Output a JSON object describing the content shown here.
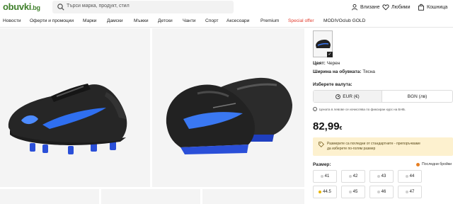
{
  "header": {
    "logo_main": "obuvki",
    "logo_tld": ".bg",
    "search_placeholder": "Търси марка, продукт, стил",
    "login": "Влизане",
    "favorites": "Любими",
    "cart": "Кошница"
  },
  "nav": {
    "items": [
      "Новости",
      "Оферти и промоции",
      "Марки",
      "Дамски",
      "Мъжки",
      "Детски",
      "Чанти",
      "Спорт",
      "Аксесоари",
      "Premium",
      "Special offer",
      "MODIVOclub GOLD"
    ],
    "special_color": "#e23b2d"
  },
  "product": {
    "color_label": "Цвят:",
    "color_value": "Черен",
    "width_label": "Ширина на обувката:",
    "width_value": "Тясна",
    "currency_label": "Изберете валута:",
    "currency_options": [
      "EUR (€)",
      "BGN (лв)"
    ],
    "currency_selected": "EUR (€)",
    "rate_note": "Цената в левове се изчислява по фиксиран курс на БНБ.",
    "price": "82,99",
    "price_currency": "€",
    "promo_line1": "Размерите са погледни от стандартните - препоръчваме",
    "promo_line2": "да изберете по-голям размер",
    "size_label": "Размер:",
    "last_pairs": "Последни бройки",
    "sizes": [
      {
        "label": "41",
        "status": "gray"
      },
      {
        "label": "42",
        "status": "gray"
      },
      {
        "label": "43",
        "status": "gray"
      },
      {
        "label": "44",
        "status": "gray"
      },
      {
        "label": "44.5",
        "status": "orange"
      },
      {
        "label": "45",
        "status": "gray"
      },
      {
        "label": "46",
        "status": "gray"
      },
      {
        "label": "47",
        "status": "gray"
      }
    ],
    "accent_color": "#3f7f2b",
    "promo_bg": "#fdf1cf"
  }
}
